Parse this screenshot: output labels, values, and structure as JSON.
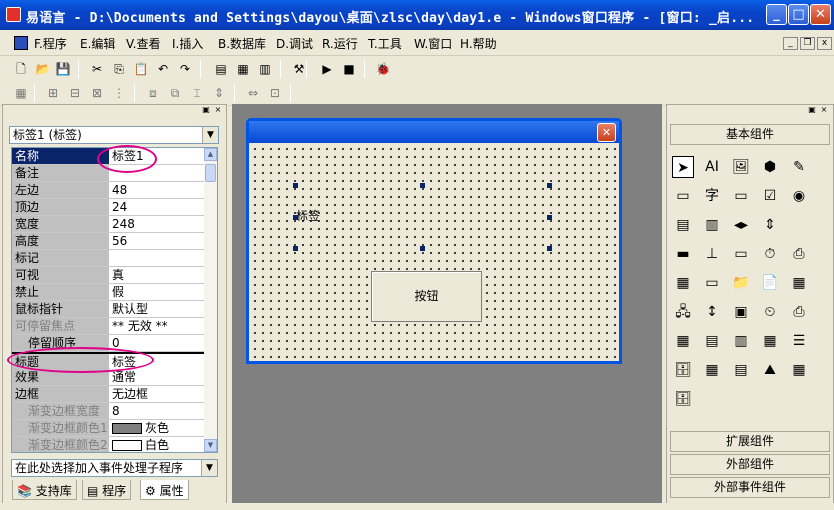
{
  "window": {
    "app_icon": "yiyuyan-app-icon",
    "title": "易语言 - D:\\Documents and Settings\\dayou\\桌面\\zlsc\\day\\day1.e - Windows窗口程序 - [窗口: _启...",
    "btn_min": "_",
    "btn_max": "□",
    "btn_close": "✕"
  },
  "menu": {
    "items": [
      "F.程序",
      "E.编辑",
      "V.查看",
      "I.插入",
      "B.数据库",
      "D.调试",
      "R.运行",
      "T.工具",
      "W.窗口",
      "H.帮助"
    ],
    "mdi_min": "_",
    "mdi_restore": "❐",
    "mdi_close": "x"
  },
  "toolbar1": {
    "icons": [
      "new-icon",
      "open-icon",
      "save-icon",
      "cut-icon",
      "copy-icon",
      "paste-icon",
      "undo-icon",
      "redo-icon",
      "window-layout-1-icon",
      "window-layout-2-icon",
      "window-layout-3-icon",
      "wand-icon",
      "run-icon",
      "stop-icon",
      "debug-icon"
    ],
    "glyphs": [
      "🗋",
      "📂",
      "💾",
      "✂",
      "⎘",
      "📋",
      "↶",
      "↷",
      "▤",
      "▦",
      "▥",
      "⚒",
      "▶",
      "■",
      "🐞"
    ]
  },
  "toolbar2": {
    "icons": [
      "grid-icon",
      "align-left-icon",
      "align-center-icon",
      "align-right-icon",
      "distribute-icon",
      "same-size-icon",
      "center-icon",
      "spacing-icon",
      "height-icon",
      "width-icon",
      "fit-icon"
    ],
    "glyphs": [
      "▦",
      "⊞",
      "⊟",
      "⊠",
      "⋮",
      "⧈",
      "⧉",
      "⌶",
      "⇕",
      "⇔",
      "⊡"
    ]
  },
  "left_panel": {
    "dock_pin": "▣",
    "dock_close": "×",
    "object_selector": "标签1 (标签)",
    "properties": [
      {
        "name": "名称",
        "value": "标签1",
        "style": "sel"
      },
      {
        "name": "备注",
        "value": ""
      },
      {
        "name": "左边",
        "value": "48"
      },
      {
        "name": "顶边",
        "value": "24"
      },
      {
        "name": "宽度",
        "value": "248"
      },
      {
        "name": "高度",
        "value": "56"
      },
      {
        "name": "标记",
        "value": ""
      },
      {
        "name": "可视",
        "value": "真"
      },
      {
        "name": "禁止",
        "value": "假"
      },
      {
        "name": "鼠标指针",
        "value": "默认型"
      },
      {
        "name": "可停留焦点",
        "value": "** 无效 **",
        "style": "grey"
      },
      {
        "name": "停留顺序",
        "value": "0",
        "style": "sub"
      },
      {
        "name": "标题",
        "value": "标签",
        "style": "divider"
      },
      {
        "name": "效果",
        "value": "通常"
      },
      {
        "name": "边框",
        "value": "无边框"
      },
      {
        "name": "渐变边框宽度",
        "value": "8",
        "style": "grey sub"
      },
      {
        "name": "渐变边框颜色1",
        "value": "灰色",
        "style": "grey sub",
        "swatch": "#808080"
      },
      {
        "name": "渐变边框颜色2",
        "value": "白色",
        "style": "grey sub",
        "swatch": "#ffffff"
      }
    ],
    "event_selector": "在此处选择加入事件处理子程序",
    "tabs": [
      "支持库",
      "程序",
      "属性"
    ]
  },
  "form": {
    "label_text": "标签",
    "button_text": "按钮"
  },
  "right_panel": {
    "header": "基本组件",
    "component_icons": [
      "pointer-icon",
      "label-icon",
      "picture-icon",
      "shape-icon",
      "drawing-board-icon",
      "groupbox-icon",
      "text-icon",
      "button-icon",
      "checkbox-icon",
      "radio-icon",
      "listbox-icon",
      "combobox-icon",
      "hscroll-icon",
      "vscroll-icon",
      "progress-icon",
      "slider-icon",
      "tabcontrol-icon",
      "timer-icon",
      "printer-icon",
      "ruler-icon",
      "image-list-icon",
      "file-icon",
      "report-icon",
      "color-picker-icon",
      "network-icon",
      "clock-icon",
      "stopwatch-icon",
      "phone-icon",
      "table-icon",
      "dataset-icon",
      "database-icon",
      "db-link-icon",
      "stack-icon",
      "odbc-icon",
      "chart-icon",
      "db-list-icon",
      "db-grid-icon",
      "mountain-icon",
      "odbc2-icon",
      "odbc3-icon"
    ],
    "footers": [
      "扩展组件",
      "外部组件",
      "外部事件组件"
    ]
  }
}
